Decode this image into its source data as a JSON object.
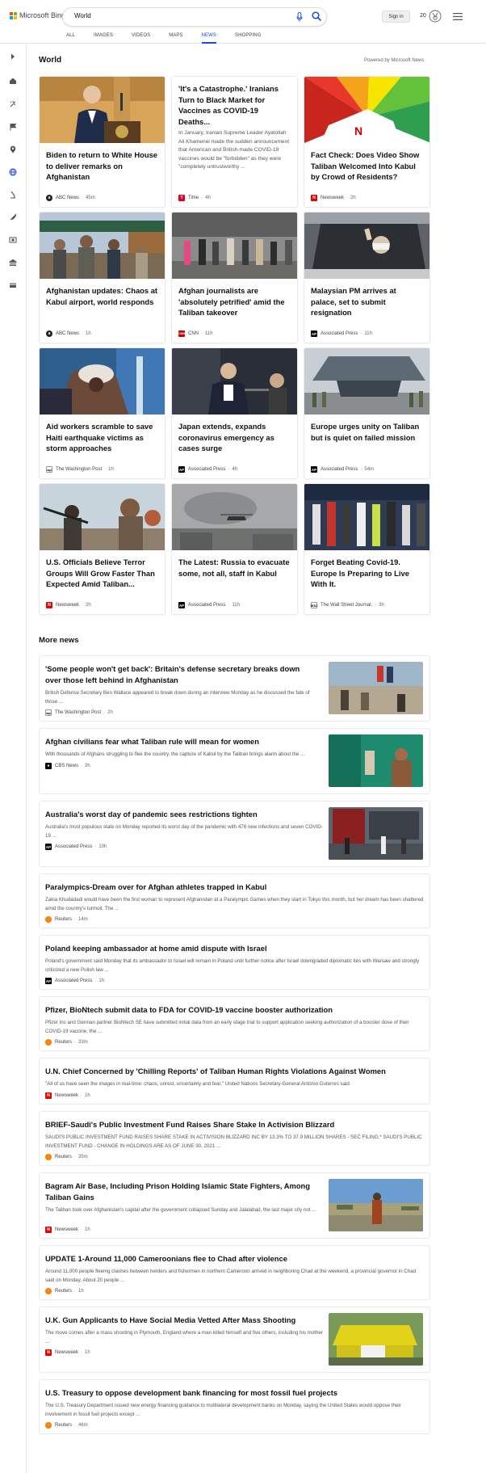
{
  "header": {
    "logo_text": "Microsoft Bing",
    "search_value": "World",
    "signin_label": "Sign in",
    "reward_points": "20",
    "nav": [
      "ALL",
      "IMAGES",
      "VIDEOS",
      "MAPS",
      "NEWS",
      "SHOPPING"
    ],
    "active_nav": "NEWS"
  },
  "main": {
    "section_title": "World",
    "powered_by": "Powered by Microsoft News",
    "more_title": "More news"
  },
  "cards": [
    {
      "title": "Biden to return to White House to deliver remarks on Afghanistan",
      "source": "ABC News",
      "time": "45m"
    },
    {
      "title": "'It's a Catastrophe.' Iranians Turn to Black Market for Vaccines as COVID-19 Deaths...",
      "desc": "In January, Iranian Supreme Leader Ayatollah Ali Khamenei made the sudden announcement that American and British-made COVID-19 vaccines would be \"forbidden\" as they were \"completely untrustworthy ...",
      "source": "Time",
      "time": "4h"
    },
    {
      "title": "Fact Check: Does Video Show Taliban Welcomed Into Kabul by Crowd of Residents?",
      "source": "Newsweek",
      "time": "2h"
    },
    {
      "title": "Afghanistan updates: Chaos at Kabul airport, world responds",
      "source": "ABC News",
      "time": "1h"
    },
    {
      "title": "Afghan journalists are 'absolutely petrified' amid the Taliban takeover",
      "source": "CNN",
      "time": "11h"
    },
    {
      "title": "Malaysian PM arrives at palace, set to submit resignation",
      "source": "Associated Press",
      "time": "11h"
    },
    {
      "title": "Aid workers scramble to save Haiti earthquake victims as storm approaches",
      "source": "The Washington Post",
      "time": "1h"
    },
    {
      "title": "Japan extends, expands coronavirus emergency as cases surge",
      "source": "Associated Press",
      "time": "4h"
    },
    {
      "title": "Europe urges unity on Taliban but is quiet on failed mission",
      "source": "Associated Press",
      "time": "54m"
    },
    {
      "title": "U.S. Officials Believe Terror Groups Will Grow Faster Than Expected Amid Taliban...",
      "source": "Newsweek",
      "time": "2h"
    },
    {
      "title": "The Latest: Russia to evacuate some, not all, staff in Kabul",
      "source": "Associated Press",
      "time": "11h"
    },
    {
      "title": "Forget Beating Covid-19. Europe Is Preparing to Live With It.",
      "source": "The Wall Street Journal.",
      "time": "3h"
    }
  ],
  "more_news": [
    {
      "title": "'Some people won't get back': Britain's defense secretary breaks down over those left behind in Afghanistan",
      "desc": "British Defense Secretary Ben Wallace appeared to break down during an interview Monday as he discussed the fate of those ...",
      "source": "The Washington Post",
      "time": "2h"
    },
    {
      "title": "Afghan civilians fear what Taliban rule will mean for women",
      "desc": "With thousands of Afghans struggling to flee the country, the capture of Kabul by the Taliban brings alarm about the ...",
      "source": "CBS News",
      "time": "3h"
    },
    {
      "title": "Australia's worst day of pandemic sees restrictions tighten",
      "desc": "Australia's most populous state on Monday reported its worst day of the pandemic with 478 new infections and seven COVID-19 ...",
      "source": "Associated Press",
      "time": "10h"
    },
    {
      "title": "Paralympics-Dream over for Afghan athletes trapped in Kabul",
      "desc": "Zakia Khudadadi would have been the first woman to represent Afghanistan at a Paralympic Games when they start in Tokyo this month, but her dream has been shattered amid the country's turmoil. The ...",
      "source": "Reuters",
      "time": "14m"
    },
    {
      "title": "Poland keeping ambassador at home amid dispute with Israel",
      "desc": "Poland's government said Monday that its ambassador to Israel will remain in Poland until further notice after Israel downgraded diplomatic ties with Warsaw and strongly criticized a new Polish law ...",
      "source": "Associated Press",
      "time": "1h"
    },
    {
      "title": "Pfizer, BioNtech submit data to FDA for COVID-19 vaccine booster authorization",
      "desc": "Pfizer Inc and German partner BioNtech SE have submitted initial data from an early stage trial to support application seeking authorization of a booster dose of their COVID-19 vaccine, the ...",
      "source": "Reuters",
      "time": "33m"
    },
    {
      "title": "U.N. Chief Concerned by 'Chilling Reports' of Taliban Human Rights Violations Against Women",
      "desc": "\"All of us have seen the images in real-time: chaos, unrest, uncertainty and fear,\" United Nations Secretary-General António Guterres said.",
      "source": "Newsweek",
      "time": "1h"
    },
    {
      "title": "BRIEF-Saudi's Public Investment Fund Raises Share Stake In Activision Blizzard",
      "desc": "SAUDI'S PUBLIC INVESTMENT FUND RAISES SHARE STAKE IN ACTIVISION BLIZZARD INC BY 13.3% TO 37.9 MILLION SHARES - SEC FILING.* SAUDI'S PUBLIC INVESTMENT FUND - CHANGE IN HOLDINGS ARE AS OF JUNE 30, 2021 ...",
      "source": "Reuters",
      "time": "35m"
    },
    {
      "title": "Bagram Air Base, Including Prison Holding Islamic State Fighters, Among Taliban Gains",
      "desc": "The Taliban took over Afghanistan's capital after the government collapsed Sunday and Jalalabad, the last major city not ...",
      "source": "Newsweek",
      "time": "1h"
    },
    {
      "title": "UPDATE 1-Around 11,000 Cameroonians flee to Chad after violence",
      "desc": "Around 11,000 people fleeing clashes between herders and fishermen in northern Cameroon arrived in neighboring Chad at the weekend, a provincial governor in Chad said on Monday. About 20 people ...",
      "source": "Reuters",
      "time": "1h"
    },
    {
      "title": "U.K. Gun Applicants to Have Social Media Vetted After Mass Shooting",
      "desc": "The move comes after a mass shooting in Plymouth, England where a man killed himself and five others, including his mother ...",
      "source": "Newsweek",
      "time": "1h"
    },
    {
      "title": "U.S. Treasury to oppose development bank financing for most fossil fuel projects",
      "desc": "The U.S. Treasury Department issued new energy financing guidance to multilateral development banks on Monday, saying the United States would oppose their involvement in fossil fuel projects except ...",
      "source": "Reuters",
      "time": "46m"
    }
  ],
  "icons": {
    "sidebar": [
      "chevron-right-icon",
      "home-icon",
      "sparkle-icon",
      "flag-icon",
      "location-pin-icon",
      "globe-icon",
      "microscope-icon",
      "rocket-icon",
      "film-icon",
      "bank-icon",
      "credit-card-icon"
    ]
  },
  "colors": {
    "accent": "#174ae4"
  }
}
